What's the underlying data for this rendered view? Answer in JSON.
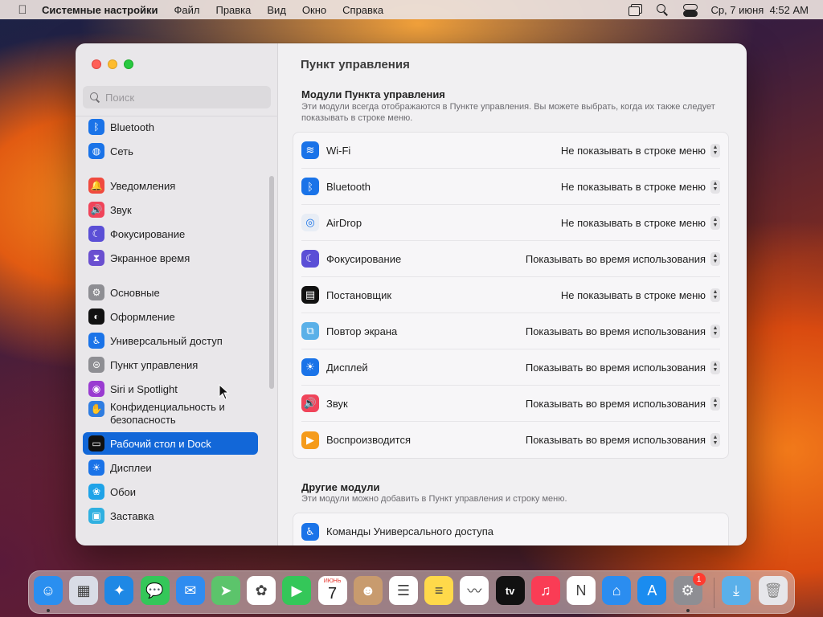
{
  "menubar": {
    "apple_icon": "apple-logo-icon",
    "app_name": "Системные настройки",
    "items": [
      "Файл",
      "Правка",
      "Вид",
      "Окно",
      "Справка"
    ],
    "clock": "Ср, 7 июня  4:52 AM"
  },
  "sidebar": {
    "search_placeholder": "Поиск",
    "items": [
      {
        "label": "Bluetooth",
        "icon": "bluetooth-icon",
        "color": "#1a73e8"
      },
      {
        "label": "Сеть",
        "icon": "globe-icon",
        "color": "#1a73e8"
      },
      {
        "label": "Уведомления",
        "icon": "bell-icon",
        "color": "#f04a3e"
      },
      {
        "label": "Звук",
        "icon": "speaker-icon",
        "color": "#f0445a"
      },
      {
        "label": "Фокусирование",
        "icon": "moon-icon",
        "color": "#5b4fd6"
      },
      {
        "label": "Экранное время",
        "icon": "hourglass-icon",
        "color": "#6a4fd0"
      },
      {
        "label": "Основные",
        "icon": "gear-icon",
        "color": "#8e8e93"
      },
      {
        "label": "Оформление",
        "icon": "appearance-icon",
        "color": "#111111"
      },
      {
        "label": "Универсальный доступ",
        "icon": "accessibility-icon",
        "color": "#1a73e8"
      },
      {
        "label": "Пункт управления",
        "icon": "control-center-icon",
        "color": "#8e8e93"
      },
      {
        "label": "Siri и Spotlight",
        "icon": "siri-icon",
        "color": "#9a3bd1"
      },
      {
        "label": "Конфиденциальность и",
        "label2": "безопасность",
        "icon": "hand-icon",
        "color": "#2f7de1"
      },
      {
        "label": "Рабочий стол и Dock",
        "icon": "dock-icon",
        "color": "#111111"
      },
      {
        "label": "Дисплеи",
        "icon": "sun-icon",
        "color": "#1a73e8"
      },
      {
        "label": "Обои",
        "icon": "flower-icon",
        "color": "#1fa3e8"
      },
      {
        "label": "Заставка",
        "icon": "screensaver-icon",
        "color": "#30b0e0"
      }
    ],
    "active_index": 12
  },
  "content": {
    "title": "Пункт управления",
    "modules": {
      "title": "Модули Пункта управления",
      "subtitle": "Эти модули всегда отображаются в Пункте управления. Вы можете выбрать, когда их также следует показывать в строке меню.",
      "rows": [
        {
          "label": "Wi-Fi",
          "value": "Не показывать в строке меню",
          "icon": "wifi-icon",
          "color": "#1a73e8"
        },
        {
          "label": "Bluetooth",
          "value": "Не показывать в строке меню",
          "icon": "bluetooth-icon",
          "color": "#1a73e8"
        },
        {
          "label": "AirDrop",
          "value": "Не показывать в строке меню",
          "icon": "airdrop-icon",
          "color": "#e8edf5"
        },
        {
          "label": "Фокусирование",
          "value": "Показывать во время использования",
          "icon": "moon-icon",
          "color": "#5b4fd6"
        },
        {
          "label": "Постановщик",
          "value": "Не показывать в строке меню",
          "icon": "stage-manager-icon",
          "color": "#111111"
        },
        {
          "label": "Повтор экрана",
          "value": "Показывать во время использования",
          "icon": "screen-mirroring-icon",
          "color": "#5ab0e8"
        },
        {
          "label": "Дисплей",
          "value": "Показывать во время использования",
          "icon": "sun-icon",
          "color": "#1a73e8"
        },
        {
          "label": "Звук",
          "value": "Показывать во время использования",
          "icon": "speaker-icon",
          "color": "#f0445a"
        },
        {
          "label": "Воспроизводится",
          "value": "Показывать во время использования",
          "icon": "play-icon",
          "color": "#f59b1b"
        }
      ]
    },
    "other": {
      "title": "Другие модули",
      "subtitle": "Эти модули можно добавить в Пункт управления и строку меню.",
      "rows": [
        {
          "label": "Команды Универсального доступа",
          "icon": "accessibility-icon",
          "color": "#1a73e8"
        }
      ]
    }
  },
  "dock": {
    "calendar_month": "ИЮНЬ",
    "calendar_day": "7",
    "tv_label": "tv",
    "settings_badge": "1",
    "apps": [
      {
        "name": "finder",
        "icon": "finder-icon",
        "color": "#2a8ff0",
        "running": true
      },
      {
        "name": "launchpad",
        "icon": "launchpad-icon",
        "color": "#d9dce6",
        "running": false
      },
      {
        "name": "safari",
        "icon": "safari-icon",
        "color": "#1e88e5",
        "running": false
      },
      {
        "name": "messages",
        "icon": "messages-icon",
        "color": "#34c759",
        "running": false
      },
      {
        "name": "mail",
        "icon": "mail-icon",
        "color": "#2f8cf0",
        "running": false
      },
      {
        "name": "maps",
        "icon": "maps-icon",
        "color": "#5cc46b",
        "running": false
      },
      {
        "name": "photos",
        "icon": "photos-icon",
        "color": "#ffffff",
        "running": false
      },
      {
        "name": "facetime",
        "icon": "facetime-icon",
        "color": "#34c759",
        "running": false
      },
      {
        "name": "calendar",
        "icon": "calendar-icon",
        "color": "#ffffff",
        "running": false
      },
      {
        "name": "contacts",
        "icon": "contacts-icon",
        "color": "#c89b6e",
        "running": false
      },
      {
        "name": "reminders",
        "icon": "reminders-icon",
        "color": "#ffffff",
        "running": false
      },
      {
        "name": "notes",
        "icon": "notes-icon",
        "color": "#ffd94a",
        "running": false
      },
      {
        "name": "freeform",
        "icon": "freeform-icon",
        "color": "#ffffff",
        "running": false
      },
      {
        "name": "tv",
        "icon": "tv-icon",
        "color": "#111111",
        "running": false
      },
      {
        "name": "music",
        "icon": "music-icon",
        "color": "#fa3c55",
        "running": false
      },
      {
        "name": "news",
        "icon": "news-icon",
        "color": "#ffffff",
        "running": false
      },
      {
        "name": "keynote",
        "icon": "keynote-icon",
        "color": "#2b8df0",
        "running": false
      },
      {
        "name": "app-store",
        "icon": "app-store-icon",
        "color": "#1a8cf0",
        "running": false
      },
      {
        "name": "system-settings",
        "icon": "gear-icon",
        "color": "#8e8e93",
        "running": true
      }
    ],
    "folder": {
      "name": "downloads",
      "icon": "folder-download-icon",
      "color": "#5ab0ea"
    },
    "trash": {
      "name": "trash",
      "icon": "trash-icon",
      "color": "#e6e6ea"
    }
  }
}
